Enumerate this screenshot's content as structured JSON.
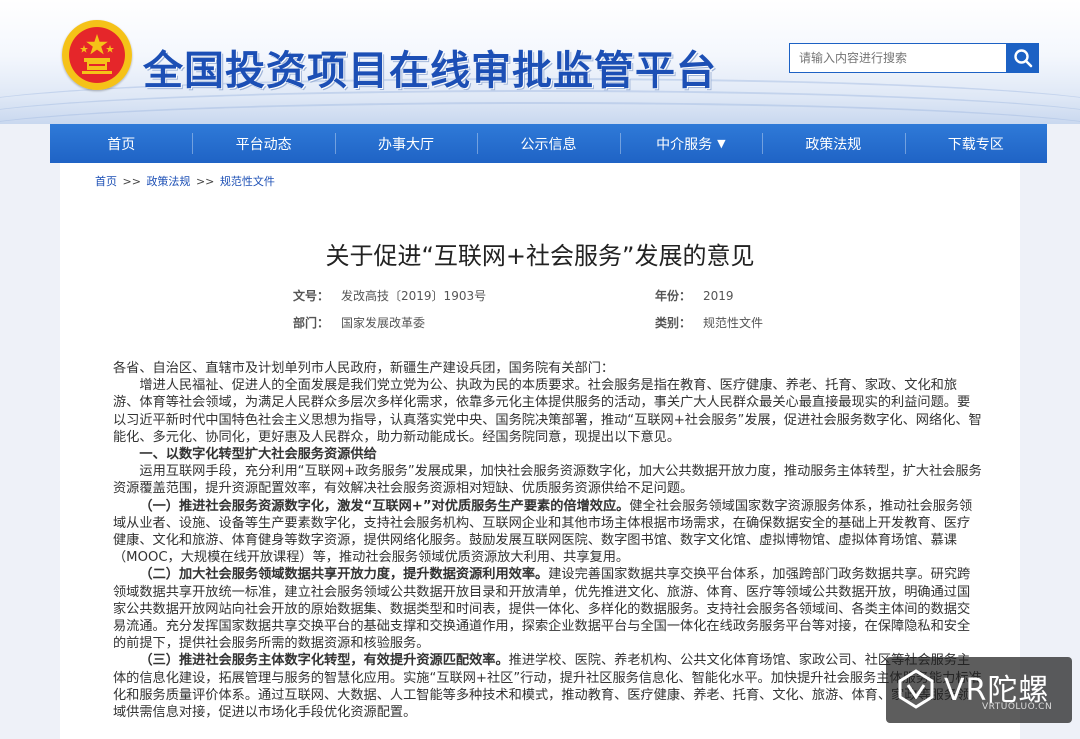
{
  "header": {
    "site_title": "全国投资项目在线审批监管平台",
    "search_placeholder": "请输入内容进行搜索",
    "emblem_icon": "national-emblem-icon",
    "brand_color": "#1c4fb5"
  },
  "nav": {
    "items": [
      {
        "label": "首页"
      },
      {
        "label": "平台动态"
      },
      {
        "label": "办事大厅"
      },
      {
        "label": "公示信息"
      },
      {
        "label": "中介服务",
        "caret": "▼"
      },
      {
        "label": "政策法规"
      },
      {
        "label": "下载专区"
      }
    ]
  },
  "breadcrumb": {
    "items": [
      "首页",
      "政策法规",
      "规范性文件"
    ],
    "separator": ">>"
  },
  "document": {
    "title": "关于促进“互联网+社会服务”发展的意见",
    "meta": {
      "doc_no_label": "文号：",
      "doc_no": "发改高技〔2019〕1903号",
      "year_label": "年份：",
      "year": "2019",
      "dept_label": "部门：",
      "dept": "国家发展改革委",
      "category_label": "类别：",
      "category": "规范性文件"
    },
    "paragraphs": {
      "p1": "各省、自治区、直辖市及计划单列市人民政府，新疆生产建设兵团，国务院有关部门：",
      "p2": "增进人民福祉、促进人的全面发展是我们党立党为公、执政为民的本质要求。社会服务是指在教育、医疗健康、养老、托育、家政、文化和旅游、体育等社会领域，为满足人民群众多层次多样化需求，依靠多元化主体提供服务的活动，事关广大人民群众最关心最直接最现实的利益问题。要以习近平新时代中国特色社会主义思想为指导，认真落实党中央、国务院决策部署，推动“互联网+社会服务”发展，促进社会服务数字化、网络化、智能化、多元化、协同化，更好惠及人民群众，助力新动能成长。经国务院同意，现提出以下意见。",
      "h1": "一、以数字化转型扩大社会服务资源供给",
      "p3": "运用互联网手段，充分利用“互联网+政务服务”发展成果，加快社会服务资源数字化，加大公共数据开放力度，推动服务主体转型，扩大社会服务资源覆盖范围，提升资源配置效率，有效解决社会服务资源相对短缺、优质服务资源供给不足问题。",
      "s1_bold": "（一）推进社会服务资源数字化，激发“互联网+”对优质服务生产要素的倍增效应。",
      "s1_text": "健全社会服务领域国家数字资源服务体系，推动社会服务领域从业者、设施、设备等生产要素数字化，支持社会服务机构、互联网企业和其他市场主体根据市场需求，在确保数据安全的基础上开发教育、医疗健康、文化和旅游、体育健身等数字资源，提供网络化服务。鼓励发展互联网医院、数字图书馆、数字文化馆、虚拟博物馆、虚拟体育场馆、慕课（MOOC，大规模在线开放课程）等，推动社会服务领域优质资源放大利用、共享复用。",
      "s2_bold": "（二）加大社会服务领域数据共享开放力度，提升数据资源利用效率。",
      "s2_text": "建设完善国家数据共享交换平台体系，加强跨部门政务数据共享。研究跨领域数据共享开放统一标准，建立社会服务领域公共数据开放目录和开放清单，优先推进文化、旅游、体育、医疗等领域公共数据开放，明确通过国家公共数据开放网站向社会开放的原始数据集、数据类型和时间表，提供一体化、多样化的数据服务。支持社会服务各领域间、各类主体间的数据交易流通。充分发挥国家数据共享交换平台的基础支撑和交换通道作用，探索企业数据平台与全国一体化在线政务服务平台等对接，在保障隐私和安全的前提下，提供社会服务所需的数据资源和核验服务。",
      "s3_bold": "（三）推进社会服务主体数字化转型，有效提升资源匹配效率。",
      "s3_text": "推进学校、医院、养老机构、公共文化体育场馆、家政公司、社区等社会服务主体的信息化建设，拓展管理与服务的智慧化应用。实施“互联网+社区”行动，提升社区服务信息化、智能化水平。加快提升社会服务主体服务能力标准化和服务质量评价体系。通过互联网、大数据、人工智能等多种技术和模式，推动教育、医疗健康、养老、托育、文化、旅游、体育、家政等服务领域供需信息对接，促进以市场化手段优化资源配置。"
    }
  },
  "watermark": {
    "cn": "VR陀螺",
    "en": "VRTUOLUO.CN",
    "logo_icon": "vr-tuoluo-logo-icon"
  }
}
